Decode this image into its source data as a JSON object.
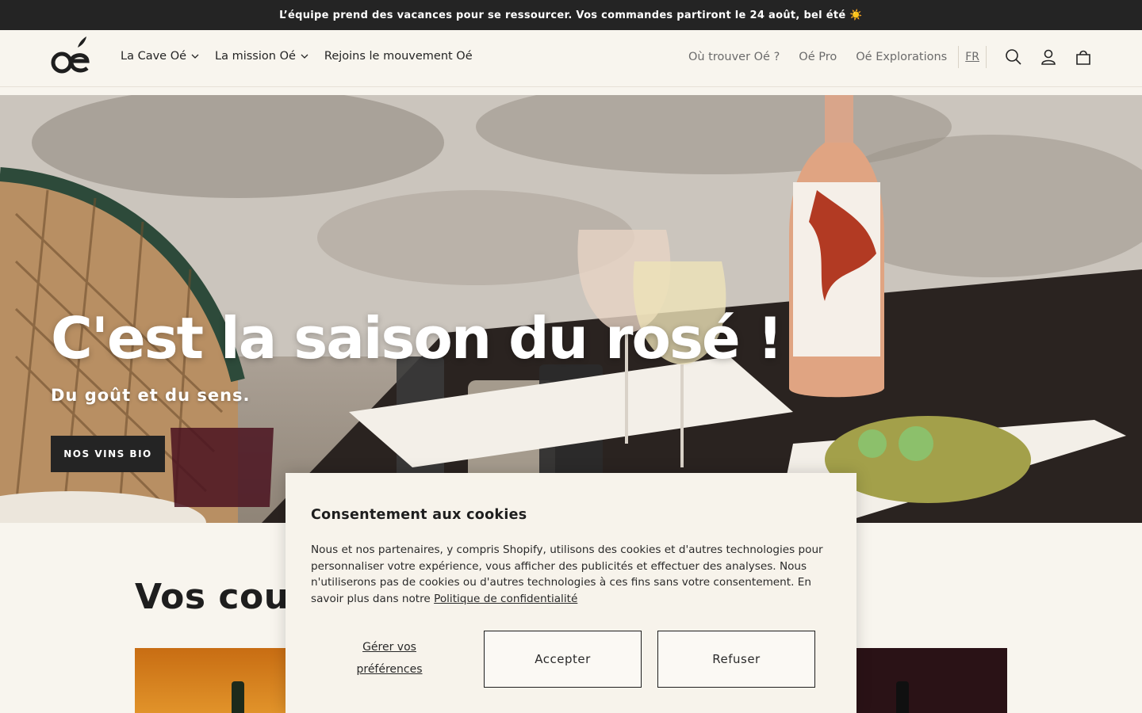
{
  "announcement": {
    "text": "L’équipe prend des vacances pour se ressourcer. Vos commandes partiront le 24 août, bel été ☀️"
  },
  "header": {
    "nav_left": [
      {
        "label": "La Cave Oé",
        "has_dropdown": true
      },
      {
        "label": "La mission Oé",
        "has_dropdown": true
      },
      {
        "label": "Rejoins le mouvement Oé",
        "has_dropdown": false
      }
    ],
    "nav_right": [
      {
        "label": "Où trouver Oé ?"
      },
      {
        "label": "Oé Pro"
      },
      {
        "label": "Oé Explorations"
      }
    ],
    "language": "FR",
    "icons": [
      "search-icon",
      "account-icon",
      "cart-icon"
    ]
  },
  "hero": {
    "title": "C'est la saison du rosé !",
    "subtitle": "Du goût et du sens.",
    "cta_label": "NOS VINS BIO"
  },
  "section": {
    "title_visible": "Vos cou"
  },
  "cookie": {
    "title": "Consentement aux cookies",
    "text": "Nous et nos partenaires, y compris Shopify, utilisons des cookies et d'autres technologies pour personnaliser votre expérience, vous afficher des publicités et effectuer des analyses. Nous n'utiliserons pas de cookies ou d'autres technologies à ces fins sans votre consentement. En savoir plus dans notre",
    "policy_link": "Politique de confidentialité",
    "manage_label": "Gérer vos préférences",
    "accept_label": "Accepter",
    "refuse_label": "Refuser"
  },
  "colors": {
    "background": "#f8f5ee",
    "announcement_bg": "#242424",
    "cta_bg": "#242424",
    "modal_bg": "#f7f3eb"
  }
}
